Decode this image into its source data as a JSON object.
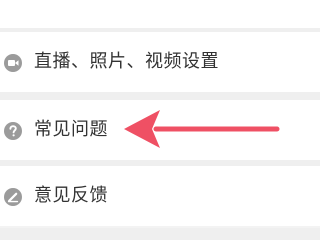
{
  "settings_list": {
    "partial_top_item_label": "",
    "items": [
      {
        "icon": "video-camera-icon",
        "label": "直播、照片、视频设置"
      },
      {
        "icon": "question-mark-icon",
        "label": "常见问题"
      },
      {
        "icon": "pencil-feedback-icon",
        "label": "意见反馈"
      }
    ]
  },
  "annotation": {
    "arrow_color": "#ef5064",
    "arrow_target": "常见问题"
  },
  "colors": {
    "background": "#f3f3f3",
    "row_background": "#ffffff",
    "icon_gray": "#9b9b9b",
    "label_text": "#333333"
  }
}
